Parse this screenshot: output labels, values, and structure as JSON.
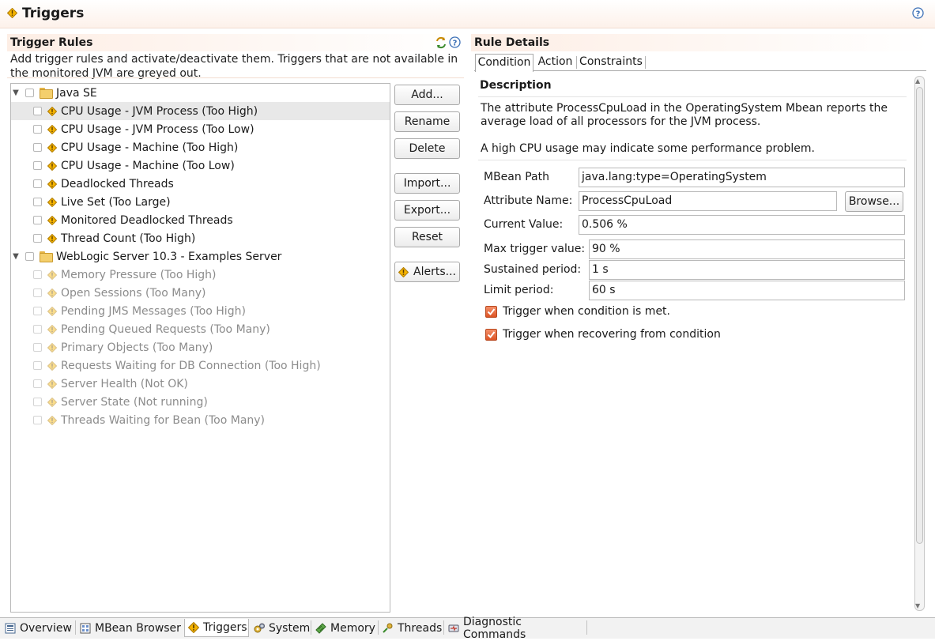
{
  "window": {
    "title": "Triggers"
  },
  "colors": {
    "warning": "#f5b400",
    "accent_checkbox": "#dd5424",
    "header_tint": "#fdeee5"
  },
  "left_panel": {
    "header": "Trigger Rules",
    "description_line1": "Add trigger rules and activate/deactivate them. Triggers that are not available in",
    "description_line2": "the monitored JVM are greyed out.",
    "tree": {
      "groups": [
        {
          "label": "Java SE",
          "items": [
            "CPU Usage - JVM Process (Too High)",
            "CPU Usage - JVM Process (Too Low)",
            "CPU Usage - Machine (Too High)",
            "CPU Usage - Machine (Too Low)",
            "Deadlocked Threads",
            "Live Set (Too Large)",
            "Monitored Deadlocked Threads",
            "Thread Count (Too High)"
          ]
        },
        {
          "label": "WebLogic Server 10.3 - Examples Server",
          "items": [
            "Memory Pressure (Too High)",
            "Open Sessions (Too Many)",
            "Pending JMS Messages (Too High)",
            "Pending Queued Requests (Too Many)",
            "Primary Objects (Too Many)",
            "Requests Waiting for DB Connection (Too High)",
            "Server Health (Not OK)",
            "Server State (Not running)",
            "Threads Waiting for Bean (Too Many)"
          ]
        }
      ]
    },
    "buttons": {
      "add": "Add...",
      "rename": "Rename",
      "delete": "Delete",
      "import": "Import...",
      "export": "Export...",
      "reset": "Reset",
      "alerts": "Alerts..."
    }
  },
  "right_panel": {
    "header": "Rule Details",
    "tabs": [
      "Condition",
      "Action",
      "Constraints"
    ],
    "description": {
      "title": "Description",
      "text1": "The attribute ProcessCpuLoad in the OperatingSystem Mbean reports the average load of all processors for the JVM process.",
      "text2": "A high CPU usage may indicate some performance problem."
    },
    "fields": {
      "mbean_path_label": "MBean Path",
      "mbean_path_value": "java.lang:type=OperatingSystem",
      "attribute_name_label": "Attribute Name:",
      "attribute_name_value": "ProcessCpuLoad",
      "browse_button": "Browse...",
      "current_value_label": "Current Value:",
      "current_value_value": "0.506 %",
      "max_trigger_label": "Max trigger value:",
      "max_trigger_value": "90 %",
      "sustained_label": "Sustained period:",
      "sustained_value": "1 s",
      "limit_label": "Limit period:",
      "limit_value": "60 s"
    },
    "checkboxes": {
      "trigger_met": "Trigger when condition is met.",
      "trigger_recover": "Trigger when recovering from condition"
    }
  },
  "bottom_tabs": [
    "Overview",
    "MBean Browser",
    "Triggers",
    "System",
    "Memory",
    "Threads",
    "Diagnostic Commands"
  ]
}
